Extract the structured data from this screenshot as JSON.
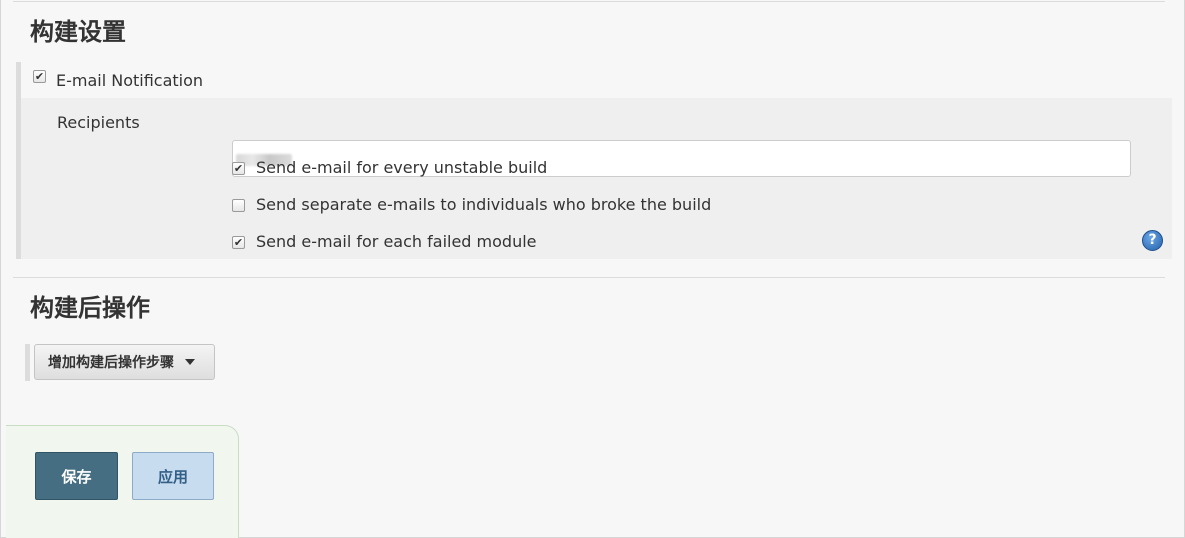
{
  "build_settings": {
    "title": "构建设置",
    "email_notification": {
      "label": "E-mail Notification",
      "checked": true,
      "recipients_label": "Recipients",
      "recipients_value": "",
      "options": [
        {
          "label": "Send e-mail for every unstable build",
          "checked": true
        },
        {
          "label": "Send separate e-mails to individuals who broke the build",
          "checked": false
        },
        {
          "label": "Send e-mail for each failed module",
          "checked": true
        }
      ],
      "help_icon": "question-mark-icon",
      "help_symbol": "?"
    }
  },
  "post_build": {
    "title": "构建后操作",
    "add_step_label": "增加构建后操作步骤",
    "dropdown_icon": "caret-down-icon"
  },
  "actions": {
    "save_label": "保存",
    "apply_label": "应用"
  },
  "colors": {
    "save_button": "#456e82",
    "apply_button": "#c7dcef",
    "help_icon": "#2460a8",
    "bottom_panel": "#f1f7ee"
  }
}
